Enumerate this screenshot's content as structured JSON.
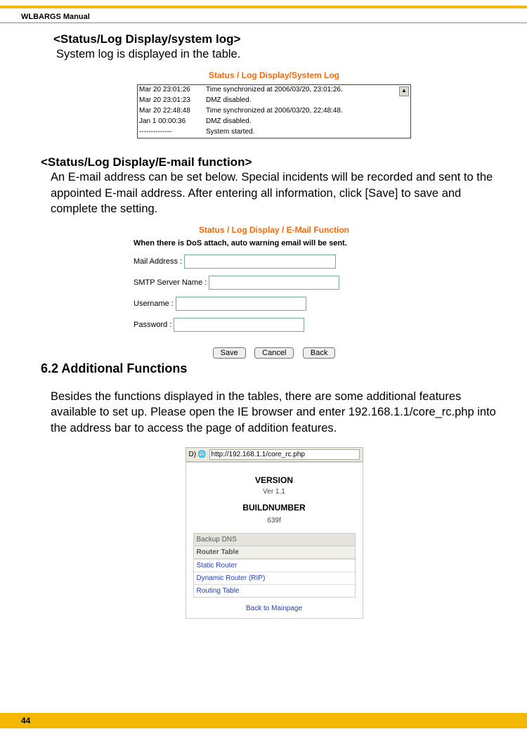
{
  "header": "WLBARGS Manual",
  "s1": {
    "heading": "<Status/Log Display/system log>",
    "text": "System log is displayed in the table.",
    "title": "Status / Log Display/System Log",
    "rows": [
      {
        "t": "Mar 20 23:01:26",
        "m": "Time synchronized at 2006/03/20, 23:01:26."
      },
      {
        "t": "Mar 20 23:01:23",
        "m": "DMZ disabled."
      },
      {
        "t": "Mar 20 22:48:48",
        "m": "Time synchronized at 2006/03/20, 22:48:48."
      },
      {
        "t": "Jan  1 00:00:36",
        "m": "DMZ disabled."
      },
      {
        "t": "--------------",
        "m": "System started."
      }
    ]
  },
  "s2": {
    "heading": "<Status/Log Display/E-mail function>",
    "text": "An E-mail address can be set below.  Special incidents will be recorded and sent to the appointed E-mail address.  After entering all information, click [Save] to save and complete the setting.",
    "title": "Status / Log Display / E-Mail Function",
    "dos": "When there is DoS attach, auto warning email will be sent.",
    "labels": {
      "mail": "Mail Address :",
      "smtp": "SMTP Server Name :",
      "user": "Username :",
      "pass": "Password :"
    },
    "btns": {
      "save": "Save",
      "cancel": "Cancel",
      "back": "Back"
    }
  },
  "s3": {
    "heading": "6.2 Additional Functions",
    "text": "Besides the functions displayed in the tables, there are some additional features available to set up.  Please open the IE browser and enter 192.168.1.1/core_rc.php into the address bar to access the page of addition features.",
    "url_prefix": "D)",
    "url": "http://192.168.1.1/core_rc.php",
    "version_lbl": "VERSION",
    "version": "Ver 1.1",
    "build_lbl": "BUILDNUMBER",
    "build": "639f",
    "backup": "Backup DNS",
    "router": "Router Table",
    "links": [
      "Static Router",
      "Dynamic Router (RIP)",
      "Routing Table"
    ],
    "back": "Back to Mainpage"
  },
  "page_num": "44"
}
